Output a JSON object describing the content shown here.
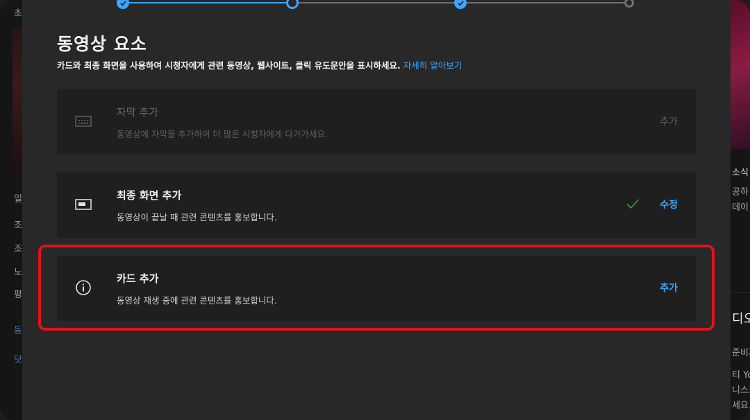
{
  "background_left": {
    "texts": [
      "초",
      "일",
      "조",
      "조",
      "노",
      "평",
      "동",
      "닷"
    ]
  },
  "background_right": {
    "texts": [
      "소식",
      "공하",
      "데이",
      "디오",
      "준비자",
      "티 Yo",
      "니스트",
      "세요."
    ]
  },
  "modal": {
    "title": "동영상 요소",
    "subtitle": "카드와 최종 화면을 사용하여 시청자에게 관련 동영상, 웹사이트, 클릭 유도문안을 표시하세요.",
    "learn_more": "자세히 알아보기",
    "stepper": {
      "steps": [
        "done",
        "current",
        "done",
        "todo"
      ]
    },
    "items": [
      {
        "heading": "자막 추가",
        "description": "동영상에 자막을 추가하여 더 많은 시청자에게 다가가세요.",
        "action": "추가",
        "icon": "subtitles-icon",
        "disabled": true,
        "completed": false
      },
      {
        "heading": "최종 화면 추가",
        "description": "동영상이 끝날 때 관련 콘텐츠를 홍보합니다.",
        "action": "수정",
        "icon": "end-screen-icon",
        "disabled": false,
        "completed": true
      },
      {
        "heading": "카드 추가",
        "description": "동영상 재생 중에 관련 콘텐츠를 홍보합니다.",
        "action": "추가",
        "icon": "info-icon",
        "disabled": false,
        "completed": false
      }
    ]
  },
  "colors": {
    "accent": "#3ea6ff",
    "highlight": "#e0121b",
    "check": "#2ba640"
  }
}
